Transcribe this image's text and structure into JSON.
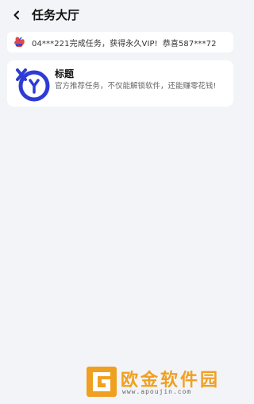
{
  "header": {
    "title": "任务大厅"
  },
  "ticker": {
    "message_1": "04***221完成任务，获得永久VIP!",
    "message_2": "恭喜587***72"
  },
  "tasks": [
    {
      "title": "标题",
      "description": "官方推荐任务，不仅能解锁软件，还能赚零花钱!"
    }
  ],
  "watermark": {
    "text": "欧金软件园",
    "url": "www.apoujin.com"
  },
  "colors": {
    "background": "#f3f4f8",
    "card": "#ffffff",
    "logo_blue": "#2d3bd6",
    "watermark_orange": "#f0a020"
  },
  "icons": {
    "back": "chevron-left-icon",
    "ticker": "gift-icon",
    "task_logo": "xy-logo-icon"
  }
}
